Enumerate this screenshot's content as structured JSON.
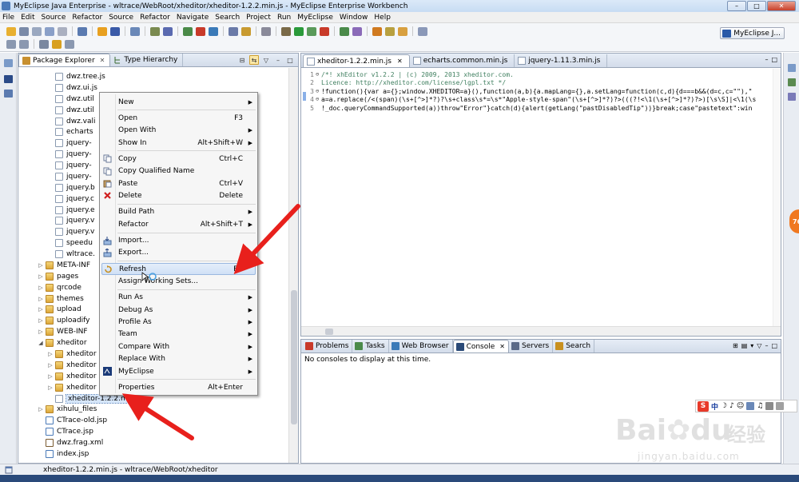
{
  "window": {
    "title": "MyEclipse Java Enterprise - wltrace/WebRoot/xheditor/xheditor-1.2.2.min.js - MyEclipse Enterprise Workbench",
    "minimize": "–",
    "maximize": "□",
    "close": "✕"
  },
  "menubar": [
    "File",
    "Edit",
    "Source",
    "Refactor",
    "Source",
    "Refactor",
    "Navigate",
    "Search",
    "Project",
    "Run",
    "MyEclipse",
    "Window",
    "Help"
  ],
  "toolbar": {
    "perspective_label": "MyEclipse J..."
  },
  "package_explorer": {
    "tabs": [
      {
        "label": "Package Explorer",
        "close": "✕"
      },
      {
        "label": "Type Hierarchy"
      }
    ],
    "tree": [
      {
        "label": "dwz.tree.js",
        "type": "file",
        "indent": 3
      },
      {
        "label": "dwz.ui.js",
        "type": "file",
        "indent": 3
      },
      {
        "label": "dwz.util",
        "type": "file",
        "indent": 3
      },
      {
        "label": "dwz.util",
        "type": "file",
        "indent": 3
      },
      {
        "label": "dwz.vali",
        "type": "file",
        "indent": 3
      },
      {
        "label": "echarts",
        "type": "file",
        "indent": 3
      },
      {
        "label": "jquery-",
        "type": "file",
        "indent": 3
      },
      {
        "label": "jquery-",
        "type": "file",
        "indent": 3
      },
      {
        "label": "jquery-",
        "type": "file",
        "indent": 3
      },
      {
        "label": "jquery-",
        "type": "file",
        "indent": 3
      },
      {
        "label": "jquery.b",
        "type": "file",
        "indent": 3
      },
      {
        "label": "jquery.c",
        "type": "file",
        "indent": 3
      },
      {
        "label": "jquery.e",
        "type": "file",
        "indent": 3
      },
      {
        "label": "jquery.v",
        "type": "file",
        "indent": 3
      },
      {
        "label": "jquery.v",
        "type": "file",
        "indent": 3
      },
      {
        "label": "speedu",
        "type": "file",
        "indent": 3
      },
      {
        "label": "wltrace.",
        "type": "file",
        "indent": 3
      },
      {
        "label": "META-INF",
        "type": "folder",
        "indent": 2,
        "arrow": "▷"
      },
      {
        "label": "pages",
        "type": "folder",
        "indent": 2,
        "arrow": "▷"
      },
      {
        "label": "qrcode",
        "type": "folder",
        "indent": 2,
        "arrow": "▷"
      },
      {
        "label": "themes",
        "type": "folder",
        "indent": 2,
        "arrow": "▷"
      },
      {
        "label": "upload",
        "type": "folder",
        "indent": 2,
        "arrow": "▷"
      },
      {
        "label": "uploadify",
        "type": "folder",
        "indent": 2,
        "arrow": "▷"
      },
      {
        "label": "WEB-INF",
        "type": "folder",
        "indent": 2,
        "arrow": "▷"
      },
      {
        "label": "xheditor",
        "type": "folder",
        "indent": 2,
        "arrow": "◢"
      },
      {
        "label": "xheditor",
        "type": "folder",
        "indent": 3,
        "arrow": "▷"
      },
      {
        "label": "xheditor",
        "type": "folder",
        "indent": 3,
        "arrow": "▷"
      },
      {
        "label": "xheditor",
        "type": "folder",
        "indent": 3,
        "arrow": "▷"
      },
      {
        "label": "xheditor",
        "type": "folder",
        "indent": 3,
        "arrow": "▷"
      },
      {
        "label": "xheditor-1.2.2.min.js",
        "type": "file",
        "indent": 3,
        "selected": true
      },
      {
        "label": "xihulu_files",
        "type": "folder",
        "indent": 2,
        "arrow": "▷"
      },
      {
        "label": "CTrace-old.jsp",
        "type": "jsp",
        "indent": 2
      },
      {
        "label": "CTrace.jsp",
        "type": "jsp",
        "indent": 2
      },
      {
        "label": "dwz.frag.xml",
        "type": "xml",
        "indent": 2
      },
      {
        "label": "index.jsp",
        "type": "jsp",
        "indent": 2
      }
    ]
  },
  "context_menu": {
    "items": [
      {
        "label": "New",
        "shortcut": "",
        "submenu": true
      },
      {
        "sep": true
      },
      {
        "label": "Open",
        "shortcut": "F3"
      },
      {
        "label": "Open With",
        "shortcut": "",
        "submenu": true
      },
      {
        "label": "Show In",
        "shortcut": "Alt+Shift+W",
        "submenu": true
      },
      {
        "sep": true
      },
      {
        "label": "Copy",
        "shortcut": "Ctrl+C",
        "icon": "copy-icon"
      },
      {
        "label": "Copy Qualified Name",
        "shortcut": "",
        "icon": "copy-icon"
      },
      {
        "label": "Paste",
        "shortcut": "Ctrl+V",
        "icon": "paste-icon"
      },
      {
        "label": "Delete",
        "shortcut": "Delete",
        "icon": "delete-icon"
      },
      {
        "sep": true
      },
      {
        "label": "Build Path",
        "shortcut": "",
        "submenu": true
      },
      {
        "label": "Refactor",
        "shortcut": "Alt+Shift+T",
        "submenu": true
      },
      {
        "sep": true
      },
      {
        "label": "Import...",
        "shortcut": "",
        "icon": "import-icon"
      },
      {
        "label": "Export...",
        "shortcut": "",
        "icon": "export-icon"
      },
      {
        "sep": true
      },
      {
        "label": "Refresh",
        "shortcut": "F5",
        "icon": "refresh-icon",
        "hover": true
      },
      {
        "label": "Assign Working Sets...",
        "shortcut": ""
      },
      {
        "sep": true
      },
      {
        "label": "Run As",
        "shortcut": "",
        "submenu": true
      },
      {
        "label": "Debug As",
        "shortcut": "",
        "submenu": true
      },
      {
        "label": "Profile As",
        "shortcut": "",
        "submenu": true
      },
      {
        "label": "Team",
        "shortcut": "",
        "submenu": true
      },
      {
        "label": "Compare With",
        "shortcut": "",
        "submenu": true
      },
      {
        "label": "Replace With",
        "shortcut": "",
        "submenu": true
      },
      {
        "label": "MyEclipse",
        "shortcut": "",
        "submenu": true,
        "icon": "myeclipse-icon"
      },
      {
        "sep": true
      },
      {
        "label": "Properties",
        "shortcut": "Alt+Enter"
      }
    ]
  },
  "editor": {
    "tabs": [
      {
        "label": "xheditor-1.2.2.min.js",
        "close": "✕"
      },
      {
        "label": "echarts.common.min.js"
      },
      {
        "label": "jquery-1.11.3.min.js"
      }
    ],
    "lines": [
      {
        "num": "1",
        "fold": "⊖",
        "text": "/*! xhEditor v1.2.2 | (c) 2009, 2013 xheditor.com.",
        "comment": true
      },
      {
        "num": "2",
        "fold": "",
        "text": "Licence: http://xheditor.com/license/lgpl.txt */",
        "comment": true
      },
      {
        "num": "3",
        "fold": "⊖",
        "text": "!function(){var a={};window.XHEDITOR=a}(),function(a,b){a.mapLang={},a.setLang=function(c,d){d===b&&(d=c,c=\"\"),\""
      },
      {
        "num": "4",
        "fold": "⊖",
        "text": "a=a.replace(/<(span)(\\s+[^>]*?)?\\s+class\\s*=\\s*\"Apple-style-span\"(\\s+[^>]*?)?>(((?!<\\1(\\s+[^>]*?)?>)[\\s\\S]|<\\1(\\s"
      },
      {
        "num": "5",
        "fold": "",
        "text": "!_doc.queryCommandSupported(a))throw\"Error\"}catch(d){alert(getLang(\"pastDisabledTip\"))}break;case\"pastetext\":win"
      }
    ]
  },
  "console": {
    "tabs": [
      {
        "label": "Problems",
        "icon": "problems-icon"
      },
      {
        "label": "Tasks",
        "icon": "tasks-icon"
      },
      {
        "label": "Web Browser",
        "icon": "globe-icon"
      },
      {
        "label": "Console",
        "icon": "console-icon",
        "close": "✕"
      },
      {
        "label": "Servers",
        "icon": "servers-icon"
      },
      {
        "label": "Search",
        "icon": "search-icon"
      }
    ],
    "message": "No consoles to display at this time."
  },
  "statusbar": {
    "text": "xheditor-1.2.2.min.js - wltrace/WebRoot/xheditor"
  },
  "float_badge": "76",
  "ime": {
    "logo": "S",
    "mode": "中",
    "punct": "♪",
    "extras": [
      "☺",
      "♫"
    ]
  },
  "watermark": {
    "brand": "Bai",
    "brand2": "du",
    "cn": "经验",
    "url": "jingyan.baidu.com"
  },
  "colors": {
    "accent": "#4a7ab8",
    "arrow": "#e8201c",
    "comment": "#3f7f5f"
  }
}
